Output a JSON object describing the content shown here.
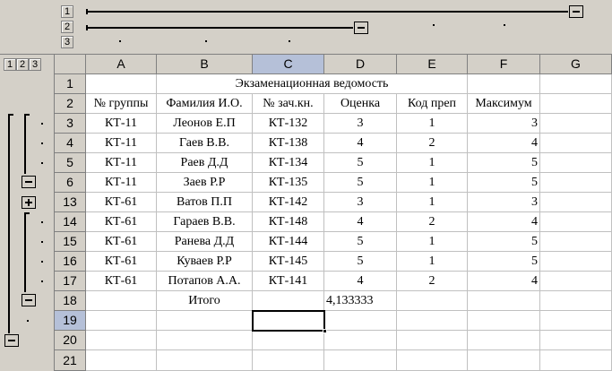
{
  "outline_levels": {
    "col_level_buttons": [
      "1",
      "2",
      "3"
    ],
    "row_level_buttons": [
      "1",
      "2",
      "3"
    ]
  },
  "columns": [
    "A",
    "B",
    "C",
    "D",
    "E",
    "F",
    "G"
  ],
  "selected_column": "C",
  "selected_row": "19",
  "title": "Экзаменационная ведомость",
  "headers": [
    "№ группы",
    "Фамилия И.О.",
    "№ зач.кн.",
    "Оценка",
    "Код преп",
    "Максимум"
  ],
  "rows": [
    {
      "row": "3",
      "cells": [
        "КТ-11",
        "Леонов Е.П",
        "КТ-132",
        "3",
        "1",
        "3"
      ]
    },
    {
      "row": "4",
      "cells": [
        "КТ-11",
        "Гаев В.В.",
        "КТ-138",
        "4",
        "2",
        "4"
      ]
    },
    {
      "row": "5",
      "cells": [
        "КТ-11",
        "Раев Д.Д",
        "КТ-134",
        "5",
        "1",
        "5"
      ]
    },
    {
      "row": "6",
      "cells": [
        "КТ-11",
        "Заев Р.Р",
        "КТ-135",
        "5",
        "1",
        "5"
      ]
    },
    {
      "row": "13",
      "cells": [
        "КТ-61",
        "Ватов П.П",
        "КТ-142",
        "3",
        "1",
        "3"
      ]
    },
    {
      "row": "14",
      "cells": [
        "КТ-61",
        "Гараев В.В.",
        "КТ-148",
        "4",
        "2",
        "4"
      ]
    },
    {
      "row": "15",
      "cells": [
        "КТ-61",
        "Ранева Д.Д",
        "КТ-144",
        "5",
        "1",
        "5"
      ]
    },
    {
      "row": "16",
      "cells": [
        "КТ-61",
        "Куваев Р.Р",
        "КТ-145",
        "5",
        "1",
        "5"
      ]
    },
    {
      "row": "17",
      "cells": [
        "КТ-61",
        "Потапов А.А.",
        "КТ-141",
        "4",
        "2",
        "4"
      ]
    }
  ],
  "total_row": {
    "row": "18",
    "label": "Итого",
    "value": "4,133333"
  },
  "empty_rows": [
    "19",
    "20",
    "21"
  ],
  "header_row_numbers": [
    "1",
    "2"
  ]
}
